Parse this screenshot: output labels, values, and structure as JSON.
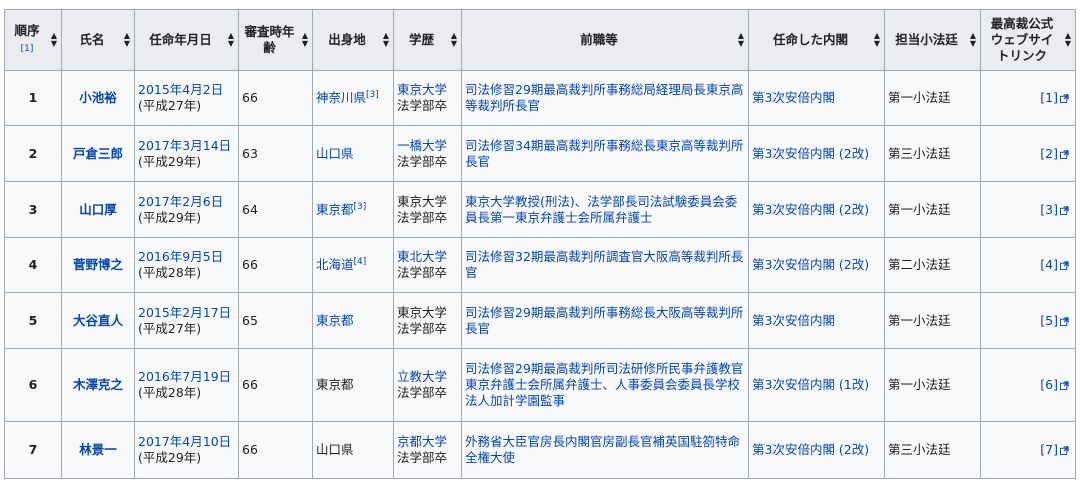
{
  "headers": [
    {
      "label": "順序",
      "note": "[1]"
    },
    {
      "label": "氏名"
    },
    {
      "label": "任命年月日"
    },
    {
      "label": "審査時年齢"
    },
    {
      "label": "出身地"
    },
    {
      "label": "学歴"
    },
    {
      "label": "前職等"
    },
    {
      "label": "任命した内閣"
    },
    {
      "label": "担当小法廷"
    },
    {
      "label": "最高裁公式ウェブサイトリンク"
    }
  ],
  "rows": [
    {
      "no": "1",
      "name": "小池裕",
      "date": "2015年4月2日",
      "era": "(平成27年)",
      "age": "66",
      "birth": "神奈川県",
      "birth_ref": "[3]",
      "birth_link": true,
      "edu1": "東京大学",
      "edu2": "法学部卒",
      "edu_link": true,
      "career": [
        "司法修習29期",
        "最高裁判所事務総局経理局長",
        "東京高等裁判所長官"
      ],
      "cabinet": "第3次安倍内閣",
      "court": "第一小法廷",
      "link": "[1]"
    },
    {
      "no": "2",
      "name": "戸倉三郎",
      "date": "2017年3月14日",
      "era": "(平成29年)",
      "age": "63",
      "birth": "山口県",
      "birth_ref": "",
      "birth_link": true,
      "edu1": "一橋大学",
      "edu2": "法学部卒",
      "edu_link": true,
      "career": [
        "司法修習34期",
        "最高裁判所事務総長",
        "東京高等裁判所長官"
      ],
      "cabinet": "第3次安倍内閣 (2改)",
      "court": "第三小法廷",
      "link": "[2]"
    },
    {
      "no": "3",
      "name": "山口厚",
      "date": "2017年2月6日",
      "era": "(平成29年)",
      "age": "64",
      "birth": "東京都",
      "birth_ref": "[3]",
      "birth_link": true,
      "edu1": "東京大学",
      "edu2": "法学部卒",
      "edu_link": false,
      "career": [
        "東京大学教授(刑法)、法学部長",
        "司法試験委員会委員長",
        "第一東京弁護士会所属弁護士"
      ],
      "cabinet": "第3次安倍内閣 (2改)",
      "court": "第一小法廷",
      "link": "[3]"
    },
    {
      "no": "4",
      "name": "菅野博之",
      "date": "2016年9月5日",
      "era": "(平成28年)",
      "age": "66",
      "birth": "北海道",
      "birth_ref": "[4]",
      "birth_link": true,
      "edu1": "東北大学",
      "edu2": "法学部卒",
      "edu_link": true,
      "career": [
        "司法修習32期",
        "最高裁判所調査官",
        "大阪高等裁判所長官"
      ],
      "cabinet": "第3次安倍内閣 (2改)",
      "court": "第二小法廷",
      "link": "[4]"
    },
    {
      "no": "5",
      "name": "大谷直人",
      "date": "2015年2月17日",
      "era": "(平成27年)",
      "age": "65",
      "birth": "東京都",
      "birth_ref": "",
      "birth_link": true,
      "edu1": "東京大学",
      "edu2": "法学部卒",
      "edu_link": false,
      "career": [
        "司法修習29期",
        "最高裁判所事務総長",
        "大阪高等裁判所長官"
      ],
      "cabinet": "第3次安倍内閣",
      "court": "第一小法廷",
      "link": "[5]"
    },
    {
      "no": "6",
      "name": "木澤克之",
      "date": "2016年7月19日",
      "era": "(平成28年)",
      "age": "66",
      "birth": "東京都",
      "birth_ref": "",
      "birth_link": false,
      "edu1": "立教大学",
      "edu2": "法学部卒",
      "edu_link": true,
      "career": [
        "司法修習29期",
        "最高裁判所司法研修所民事弁護教官",
        "東京弁護士会所属弁護士、人事委員会委員長",
        "学校法人加計学園監事"
      ],
      "cabinet": "第3次安倍内閣 (1改)",
      "court": "第一小法廷",
      "link": "[6]"
    },
    {
      "no": "7",
      "name": "林景一",
      "date": "2017年4月10日",
      "era": "(平成29年)",
      "age": "66",
      "birth": "山口県",
      "birth_ref": "",
      "birth_link": false,
      "edu1": "京都大学",
      "edu2": "法学部卒",
      "edu_link": true,
      "career": [
        "外務省大臣官房長",
        "内閣官房副長官補",
        "英国駐箚特命全権大使"
      ],
      "cabinet": "第3次安倍内閣 (2改)",
      "court": "第三小法廷",
      "link": "[7]"
    }
  ]
}
